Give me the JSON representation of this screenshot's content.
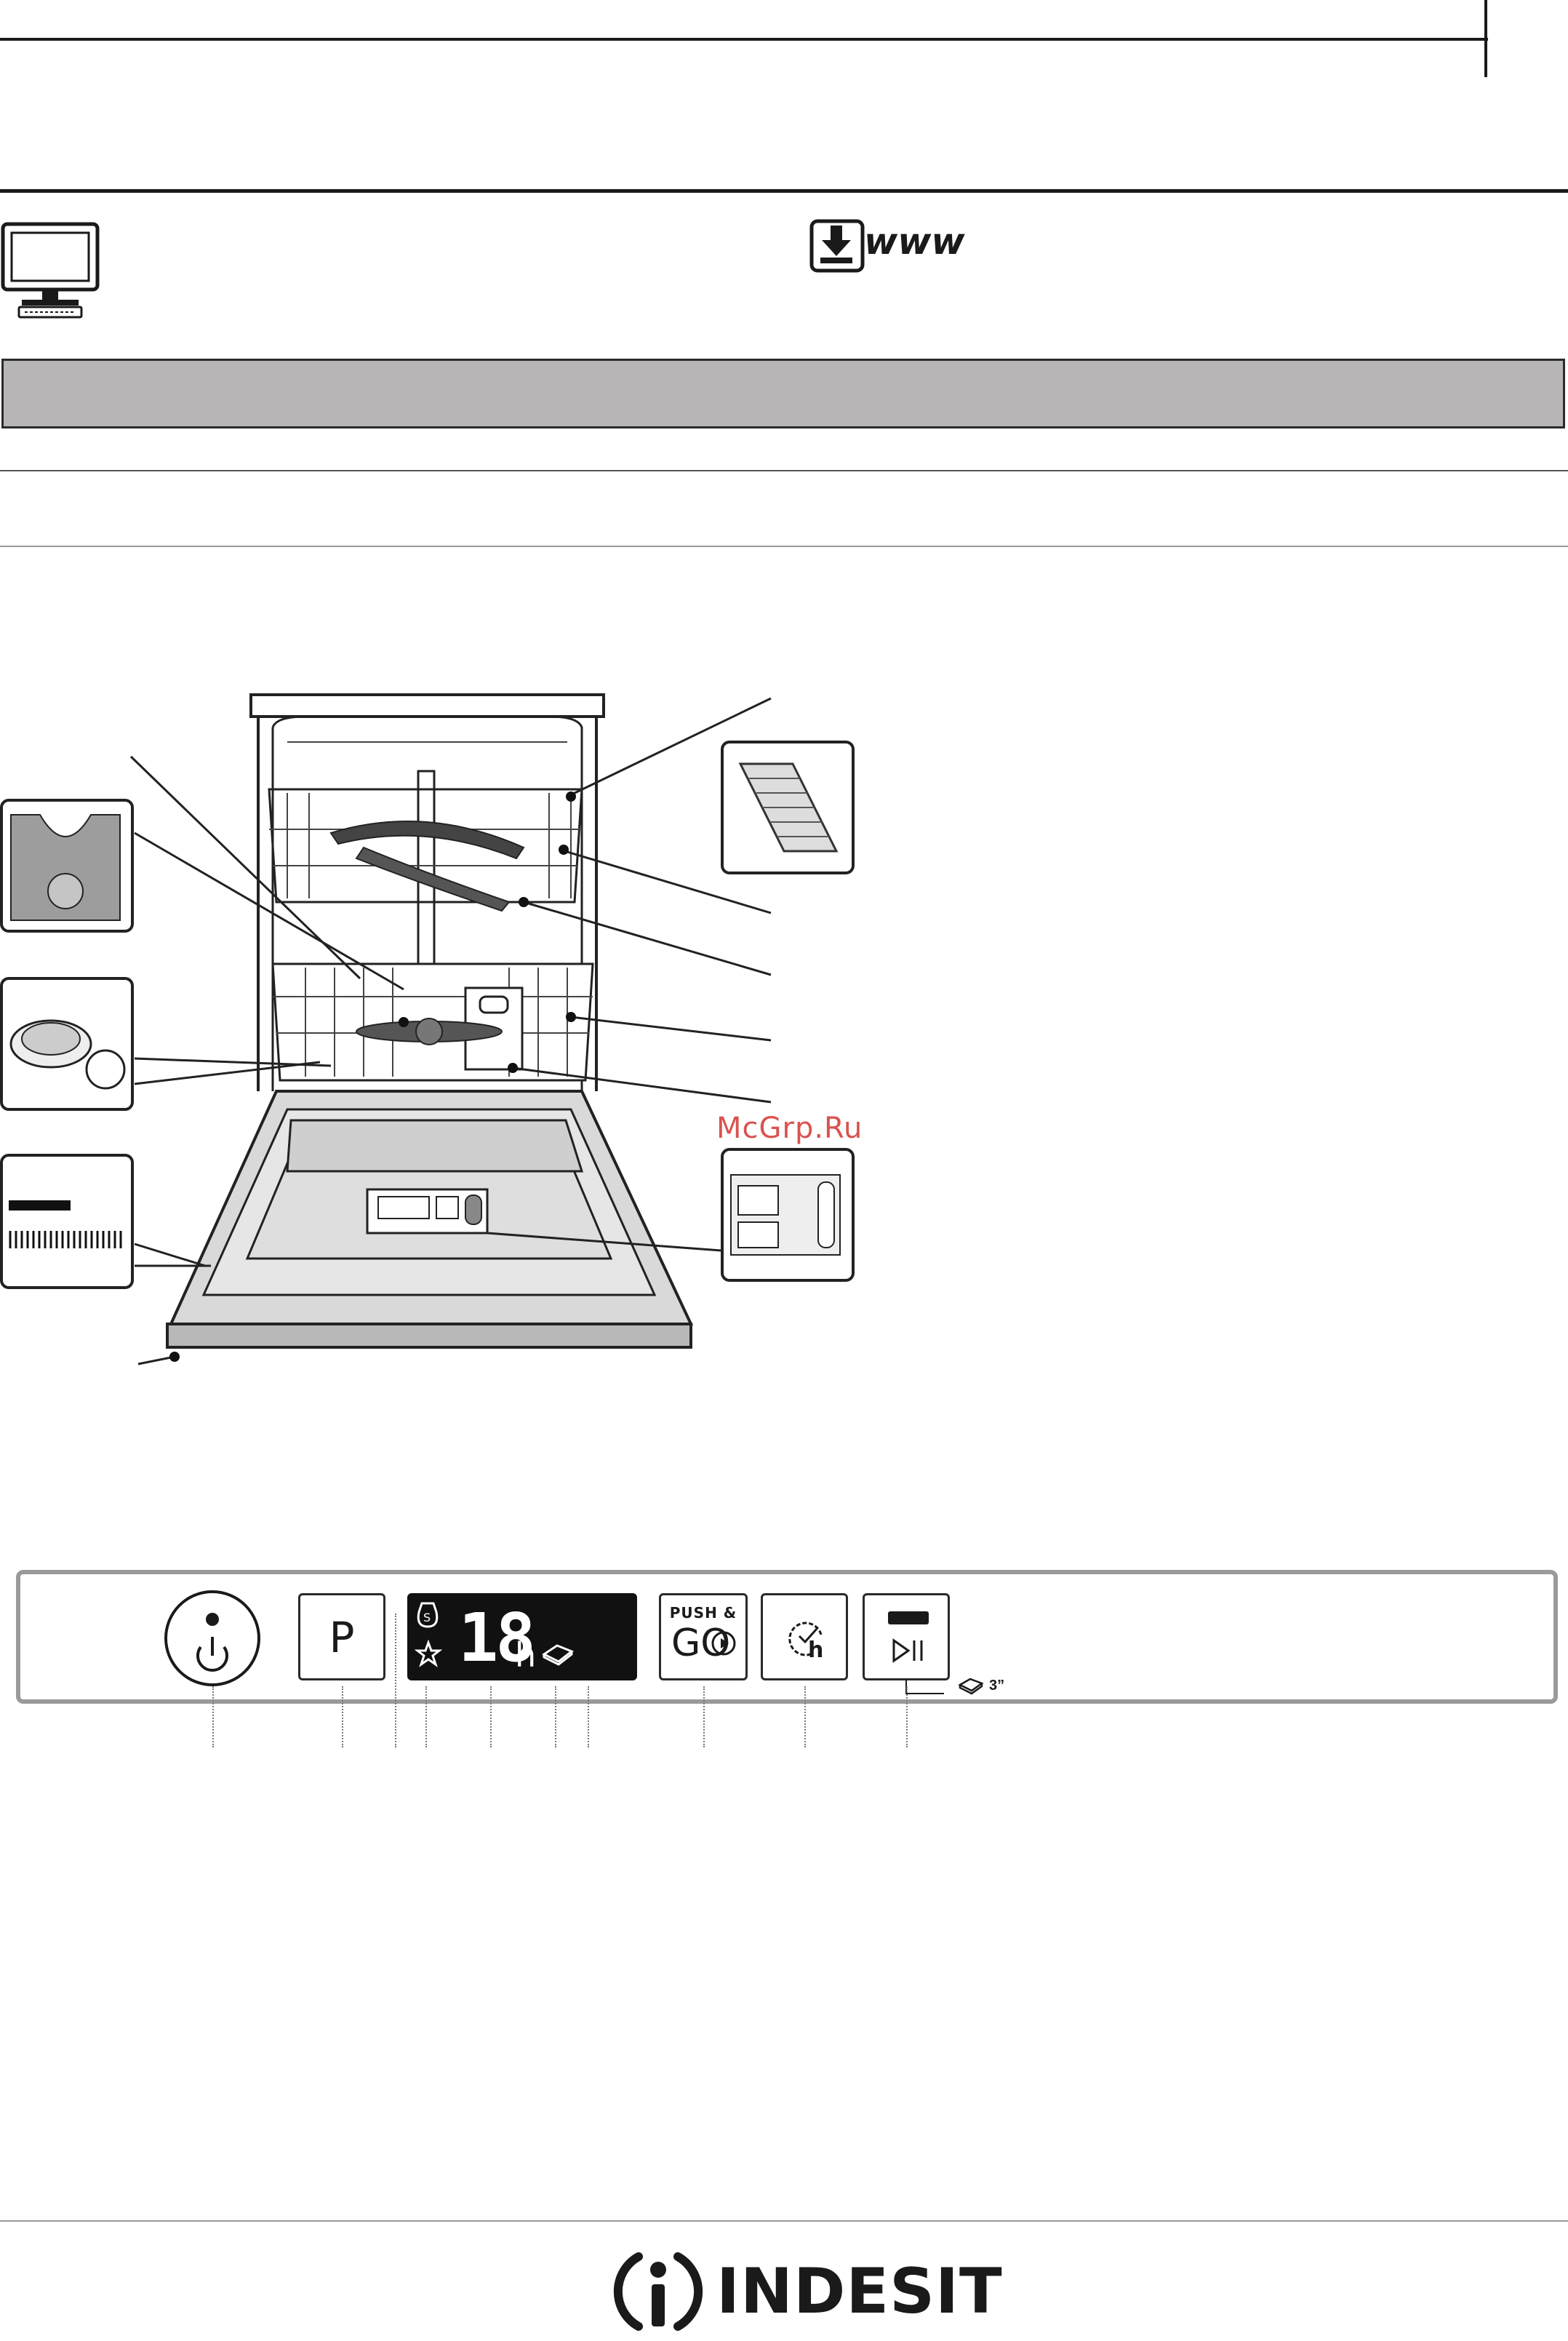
{
  "header": {
    "www_label": "www"
  },
  "watermark": {
    "text": "McGrp.Ru"
  },
  "control_panel": {
    "program_button_label": "P",
    "display": {
      "digits": "18",
      "unit": "h"
    },
    "push_go": {
      "line1": "PUSH &",
      "line2": "GO"
    },
    "delay_label": "h",
    "tablet_hold_label": "3”"
  },
  "footer": {
    "brand": "INDESIT"
  },
  "icons": [
    "monitor-icon",
    "download-icon",
    "power-icon",
    "salt-icon",
    "rinse-aid-icon",
    "tablet-icon",
    "delay-icon",
    "start-pause-icon",
    "play-pause-icon"
  ]
}
